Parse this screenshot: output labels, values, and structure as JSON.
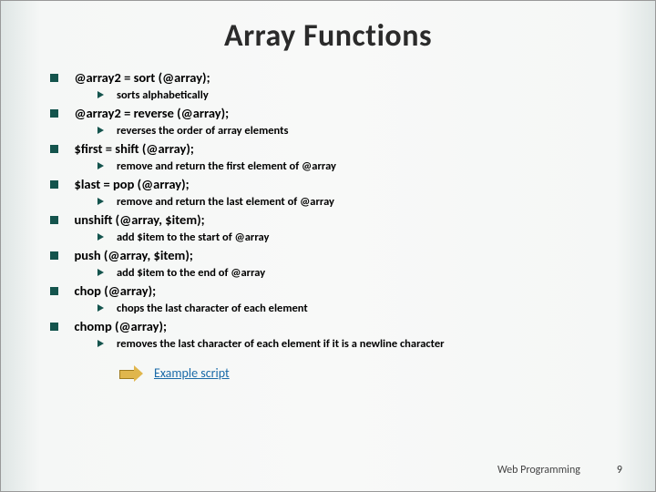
{
  "title": "Array Functions",
  "items": [
    {
      "code": "@array2 = sort (@array);",
      "desc": "sorts alphabetically"
    },
    {
      "code": "@array2 = reverse (@array);",
      "desc": "reverses the order of array elements"
    },
    {
      "code": "$first = shift (@array);",
      "desc": "remove and return the first element of @array"
    },
    {
      "code": "$last = pop (@array);",
      "desc": "remove and return the last element of @array"
    },
    {
      "code": "unshift (@array, $item);",
      "desc": "add $item to the start of @array"
    },
    {
      "code": "push (@array, $item);",
      "desc": "add $item to the end of @array"
    },
    {
      "code": "chop (@array);",
      "desc": "chops the last character of each element"
    },
    {
      "code": "chomp (@array);",
      "desc": "removes the last character of each element if it is a newline character"
    }
  ],
  "link": {
    "label": "Example script"
  },
  "footer": {
    "text": "Web Programming",
    "page": "9"
  }
}
